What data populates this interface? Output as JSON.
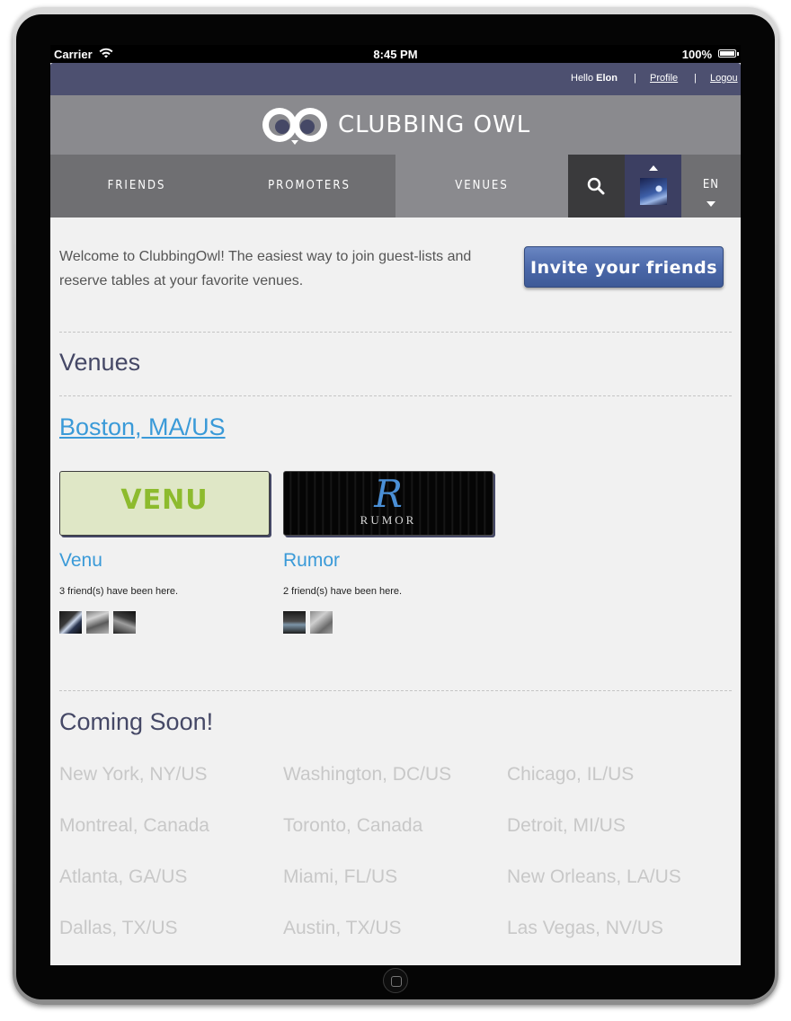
{
  "status_bar": {
    "carrier": "Carrier",
    "time": "8:45 PM",
    "battery": "100%"
  },
  "user_bar": {
    "hello_prefix": "Hello ",
    "username": "Elon",
    "separator": "|",
    "profile": "Profile",
    "logout": "Logou"
  },
  "brand": {
    "name": "CLUBBING OWL"
  },
  "nav": {
    "items": [
      {
        "label": "FRIENDS"
      },
      {
        "label": "PROMOTERS"
      },
      {
        "label": "VENUES",
        "active": true
      }
    ],
    "language": "EN"
  },
  "welcome": {
    "text": "Welcome to ClubbingOwl! The easiest way to join guest-lists and reserve tables at your favorite venues.",
    "invite_button": "Invite your friends"
  },
  "venues_section": {
    "title": "Venues",
    "city": "Boston, MA/US",
    "venues": [
      {
        "name": "Venu",
        "logo_text": "VENU",
        "friends_text": "3 friend(s) have been here.",
        "friend_count": 3
      },
      {
        "name": "Rumor",
        "logo_initial": "R",
        "logo_text": "RUMOR",
        "friends_text": "2 friend(s) have been here.",
        "friend_count": 2
      }
    ]
  },
  "coming_soon": {
    "title": "Coming Soon!",
    "cities": [
      "New York, NY/US",
      "Washington, DC/US",
      "Chicago, IL/US",
      "Montreal, Canada",
      "Toronto, Canada",
      "Detroit, MI/US",
      "Atlanta, GA/US",
      "Miami, FL/US",
      "New Orleans, LA/US",
      "Dallas, TX/US",
      "Austin, TX/US",
      "Las Vegas, NV/US"
    ]
  },
  "colors": {
    "header_bar": "#4d5070",
    "logo_bar": "#8a8a8e",
    "nav_bar": "#6f6f72",
    "link_blue": "#3a9ad8",
    "invite_button": "#4a67a8"
  }
}
